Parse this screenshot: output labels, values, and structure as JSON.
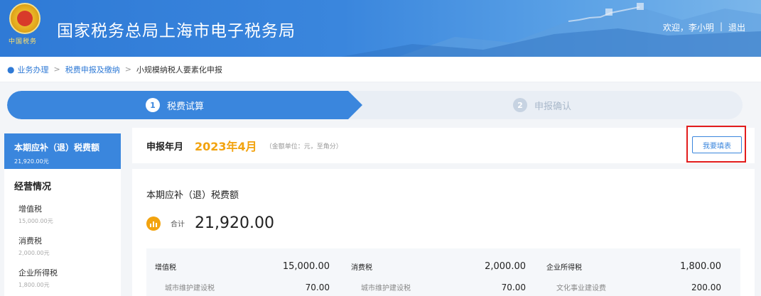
{
  "header": {
    "emblem_text": "中国税务",
    "site_title": "国家税务总局上海市电子税务局",
    "welcome": "欢迎，李小明",
    "separator": "|",
    "logout": "退出"
  },
  "breadcrumb": {
    "items": [
      "业务办理",
      "税费申报及缴纳",
      "小规模纳税人要素化申报"
    ]
  },
  "steps": [
    {
      "num": "1",
      "label": "税费试算",
      "active": true
    },
    {
      "num": "2",
      "label": "申报确认",
      "active": false
    }
  ],
  "sidebar": {
    "active": {
      "label": "本期应补（退）税费额",
      "value": "21,920.00元"
    },
    "section": "经营情况",
    "items": [
      {
        "label": "增值税",
        "value": "15,000.00元"
      },
      {
        "label": "消费税",
        "value": "2,000.00元"
      },
      {
        "label": "企业所得税",
        "value": "1,800.00元"
      }
    ]
  },
  "period": {
    "label": "申报年月",
    "value": "2023年4月",
    "note": "（金额单位：元，至角分）",
    "fill_button": "我要填表"
  },
  "summary": {
    "title": "本期应补（退）税费额",
    "total_label": "合计",
    "total_amount": "21,920.00",
    "columns": [
      {
        "name": "增值税",
        "amount": "15,000.00",
        "sub_name": "城市维护建设税",
        "sub_amount": "70.00"
      },
      {
        "name": "消费税",
        "amount": "2,000.00",
        "sub_name": "城市维护建设税",
        "sub_amount": "70.00"
      },
      {
        "name": "企业所得税",
        "amount": "1,800.00",
        "sub_name": "文化事业建设费",
        "sub_amount": "200.00"
      }
    ]
  },
  "colors": {
    "primary": "#3a86dd",
    "accent_orange": "#f2a30f",
    "highlight_red": "#e21c1c"
  }
}
